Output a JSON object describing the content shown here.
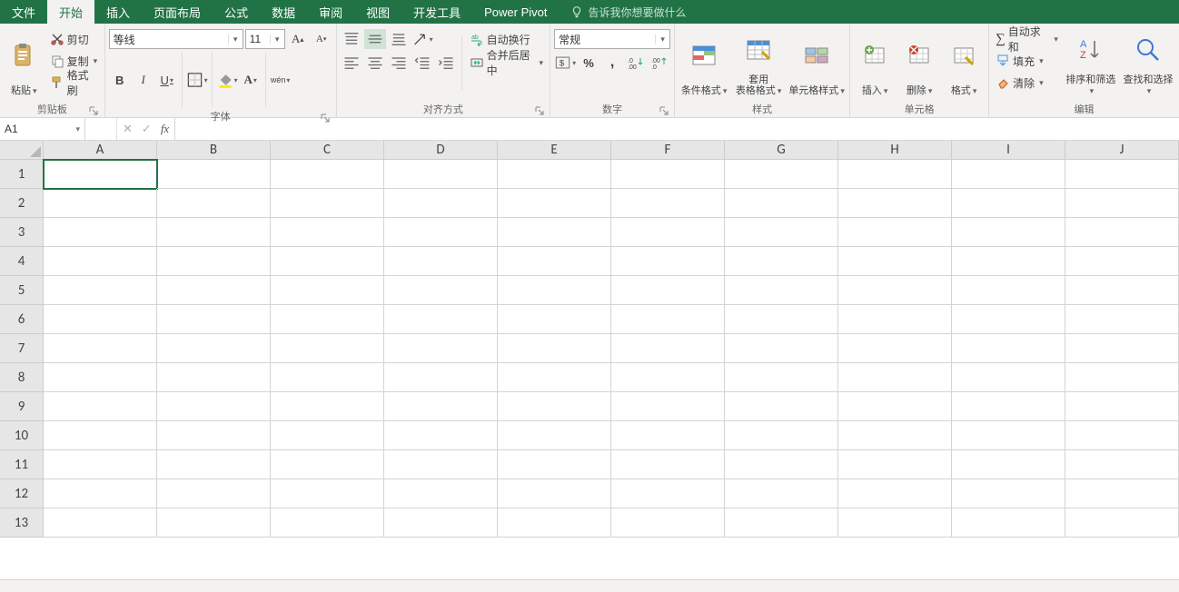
{
  "tabs": {
    "file": "文件",
    "home": "开始",
    "insert": "插入",
    "pageLayout": "页面布局",
    "formulas": "公式",
    "data": "数据",
    "review": "审阅",
    "view": "视图",
    "developer": "开发工具",
    "powerPivot": "Power Pivot"
  },
  "tellMe": "告诉我你想要做什么",
  "clipboard": {
    "paste": "粘贴",
    "cut": "剪切",
    "copy": "复制",
    "formatPainter": "格式刷",
    "groupLabel": "剪贴板"
  },
  "font": {
    "name": "等线",
    "size": "11",
    "bold": "B",
    "italic": "I",
    "underline": "U",
    "phonetic": "wén",
    "groupLabel": "字体"
  },
  "alignment": {
    "wrap": "自动换行",
    "merge": "合并后居中",
    "groupLabel": "对齐方式"
  },
  "number": {
    "format": "常规",
    "groupLabel": "数字"
  },
  "styles": {
    "conditional": "条件格式",
    "tableFormat": "套用\n表格格式",
    "cellStyles": "单元格样式",
    "groupLabel": "样式"
  },
  "cells": {
    "insert": "插入",
    "delete": "删除",
    "format": "格式",
    "groupLabel": "单元格"
  },
  "editing": {
    "autosum": "自动求和",
    "fill": "填充",
    "clear": "清除",
    "sortFilter": "排序和筛选",
    "findSelect": "查找和选择",
    "groupLabel": "编辑"
  },
  "formulaBar": {
    "nameBox": "A1",
    "fx": "fx",
    "value": ""
  },
  "grid": {
    "columns": [
      "A",
      "B",
      "C",
      "D",
      "E",
      "F",
      "G",
      "H",
      "I",
      "J"
    ],
    "rows": [
      "1",
      "2",
      "3",
      "4",
      "5",
      "6",
      "7",
      "8",
      "9",
      "10",
      "11",
      "12",
      "13"
    ]
  }
}
